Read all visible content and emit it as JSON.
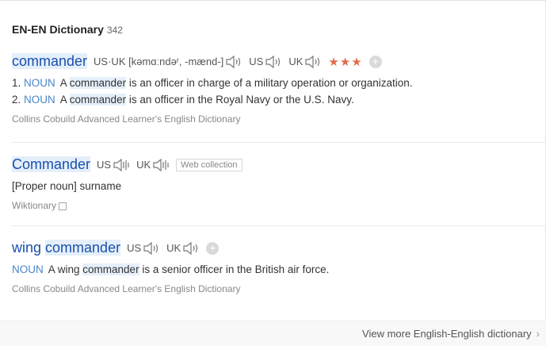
{
  "header": {
    "title": "EN-EN Dictionary",
    "count": "342"
  },
  "entries": [
    {
      "word": "commander",
      "phonetic": "US·UK [kəmɑːndəʳ, -mænd-]",
      "us_label": "US",
      "uk_label": "UK",
      "stars": "★★★",
      "defs": [
        {
          "num": "1.",
          "pos": "NOUN",
          "pre": "A ",
          "kw": "commander",
          "post": " is an officer in charge of a military operation or organization."
        },
        {
          "num": "2.",
          "pos": "NOUN",
          "pre": "A ",
          "kw": "commander",
          "post": " is an officer in the Royal Navy or the U.S. Navy."
        }
      ],
      "source": "Collins Cobuild Advanced Learner's English Dictionary"
    },
    {
      "word": "Commander",
      "us_label": "US",
      "uk_label": "UK",
      "tag": "Web collection",
      "def": "[Proper noun] surname",
      "source": "Wiktionary"
    },
    {
      "word_pre": "wing ",
      "word_kw": "commander",
      "us_label": "US",
      "uk_label": "UK",
      "def": {
        "pos": "NOUN",
        "pre": "A wing ",
        "kw": "commander",
        "post": " is a senior officer in the British air force."
      },
      "source": "Collins Cobuild Advanced Learner's English Dictionary"
    }
  ],
  "footer": {
    "more_label": "View more English-English dictionary",
    "chevron": "›"
  },
  "colors": {
    "word": "#1a4fae",
    "pos": "#4a86c7",
    "stars": "#e06b4b",
    "highlight": "#e6f0fb"
  }
}
